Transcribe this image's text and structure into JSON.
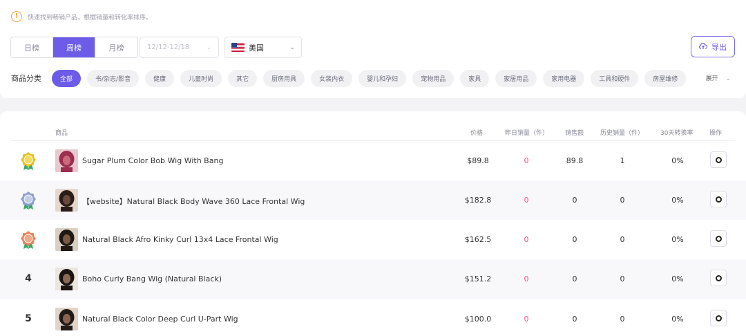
{
  "notice": {
    "text": "快速找到畅销产品，根据销量和转化率排序。",
    "icon": "exclamation-circle-icon"
  },
  "period_tabs": [
    {
      "label": "日榜",
      "active": false
    },
    {
      "label": "周榜",
      "active": true
    },
    {
      "label": "月榜",
      "active": false
    }
  ],
  "date_range": {
    "value": "12/12-12/18",
    "icon": "chevron-down-icon"
  },
  "country": {
    "label": "美国",
    "flag": "us-flag-icon",
    "icon": "chevron-down-icon"
  },
  "export": {
    "label": "导出",
    "icon": "cloud-upload-icon"
  },
  "category": {
    "label": "商品分类",
    "chips": [
      "全部",
      "书/杂志/影音",
      "健康",
      "儿童时尚",
      "其它",
      "厨房用具",
      "女装内衣",
      "婴儿和孕妇",
      "宠物用品",
      "家具",
      "家居用品",
      "家用电器",
      "工具和硬件",
      "房屋维修"
    ],
    "active_index": 0,
    "expand_label": "展开",
    "expand_icon": "chevron-down-icon"
  },
  "table": {
    "headers": {
      "product": "商品",
      "price": "价格",
      "yesterday_sales": "昨日销量（件）",
      "sales_amount": "销售额",
      "history_sales": "历史销量（件）",
      "conversion": "30天转换率",
      "action": "操作"
    },
    "rows": [
      {
        "rank": "1",
        "medal": "gold",
        "name": "Sugar Plum Color Bob Wig With Bang",
        "price": "$89.8",
        "yesterday_sales": "0",
        "sales_amount": "89.8",
        "history_sales": "1",
        "conversion": "0%"
      },
      {
        "rank": "2",
        "medal": "silver",
        "name": "【website】Natural Black Body Wave 360 Lace Frontal Wig",
        "price": "$182.8",
        "yesterday_sales": "0",
        "sales_amount": "0",
        "history_sales": "0",
        "conversion": "0%"
      },
      {
        "rank": "3",
        "medal": "bronze",
        "name": "Natural Black Afro Kinky Curl 13x4 Lace Frontal Wig",
        "price": "$162.5",
        "yesterday_sales": "0",
        "sales_amount": "0",
        "history_sales": "0",
        "conversion": "0%"
      },
      {
        "rank": "4",
        "medal": "",
        "name": "Boho Curly Bang Wig (Natural Black)",
        "price": "$151.2",
        "yesterday_sales": "0",
        "sales_amount": "0",
        "history_sales": "0",
        "conversion": "0%"
      },
      {
        "rank": "5",
        "medal": "",
        "name": "Natural Black Color Deep Curl U-Part Wig",
        "price": "$100.0",
        "yesterday_sales": "0",
        "sales_amount": "0",
        "history_sales": "0",
        "conversion": "0%"
      }
    ]
  },
  "colors": {
    "accent": "#6c5ce7",
    "pink_value": "#ff4d8d",
    "medal_gold": "#e8c22a",
    "medal_silver": "#8e9fd0",
    "medal_bronze": "#e8865a",
    "notice_icon": "#f0a43a"
  }
}
